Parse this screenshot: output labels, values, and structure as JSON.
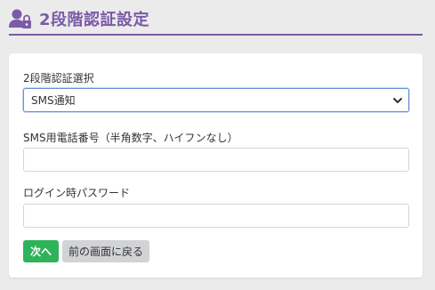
{
  "header": {
    "title": "2段階認証設定",
    "icon": "user-lock-icon",
    "accent_color": "#7b5aa6"
  },
  "form": {
    "method_label": "2段階認証選択",
    "method_value": "SMS通知",
    "phone_label": "SMS用電話番号（半角数字、ハイフンなし）",
    "phone_value": "",
    "password_label": "ログイン時パスワード",
    "password_value": ""
  },
  "buttons": {
    "next_label": "次へ",
    "back_label": "前の画面に戻る",
    "next_color": "#2fb35a"
  }
}
